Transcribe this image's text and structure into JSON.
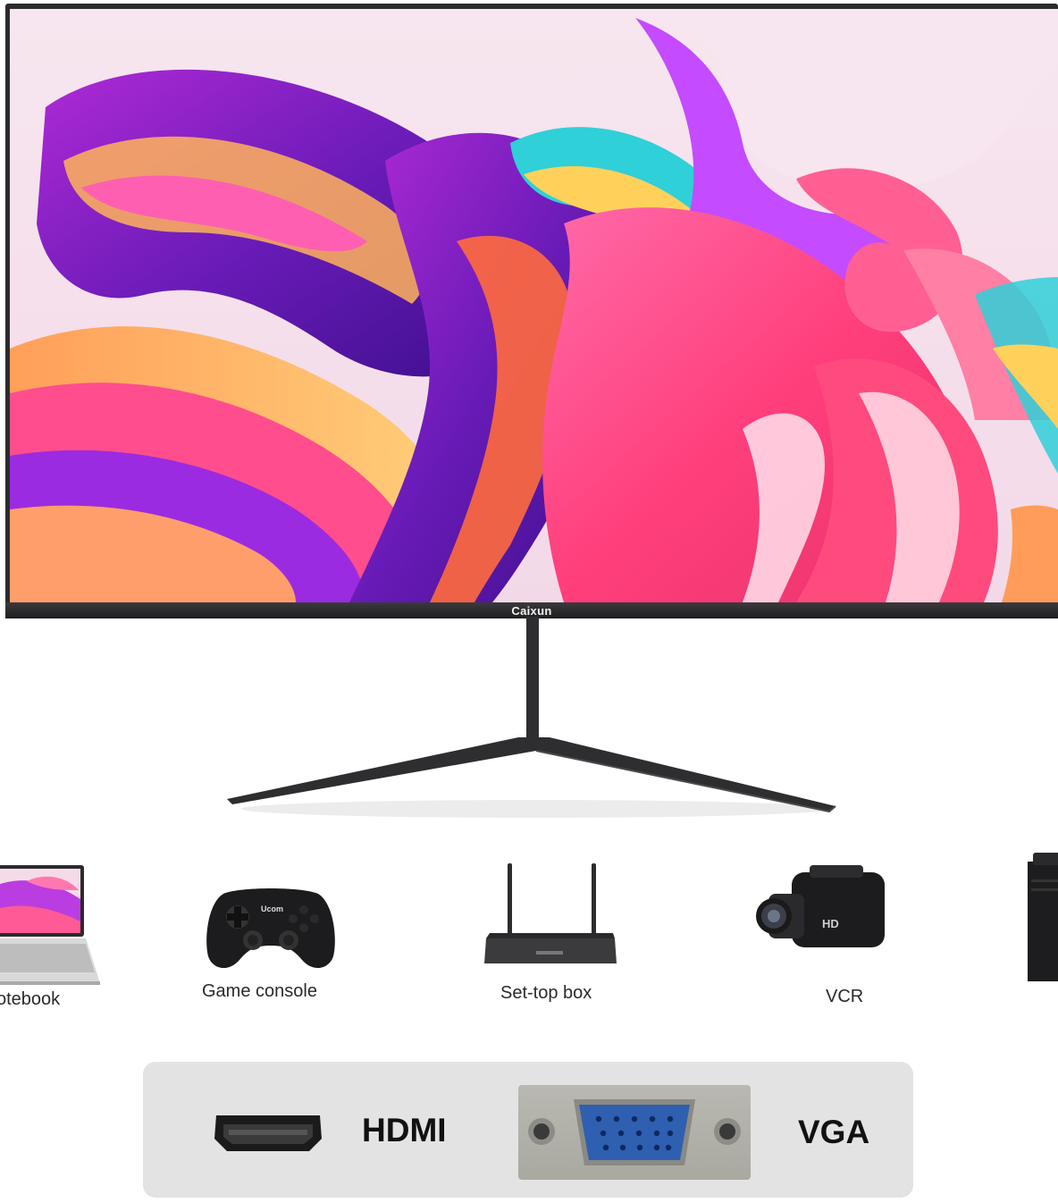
{
  "monitor": {
    "brand": "Caixun"
  },
  "devices": [
    {
      "label": "otebook",
      "icon": "laptop-icon"
    },
    {
      "label": "Game console",
      "icon": "gamepad-icon"
    },
    {
      "label": "Set-top box",
      "icon": "router-icon"
    },
    {
      "label": "VCR",
      "icon": "camcorder-icon"
    },
    {
      "label": "",
      "icon": "desktop-tower-icon"
    }
  ],
  "gamepad_logo": "Ucom",
  "camcorder_badge": "HD",
  "ports": [
    {
      "label": "HDMI",
      "icon": "hdmi-port-icon"
    },
    {
      "label": "VGA",
      "icon": "vga-port-icon"
    }
  ],
  "colors": {
    "bezel": "#2b2b2e",
    "panel": "#e3e3e3",
    "vga_connector": "#2f5fb0"
  }
}
